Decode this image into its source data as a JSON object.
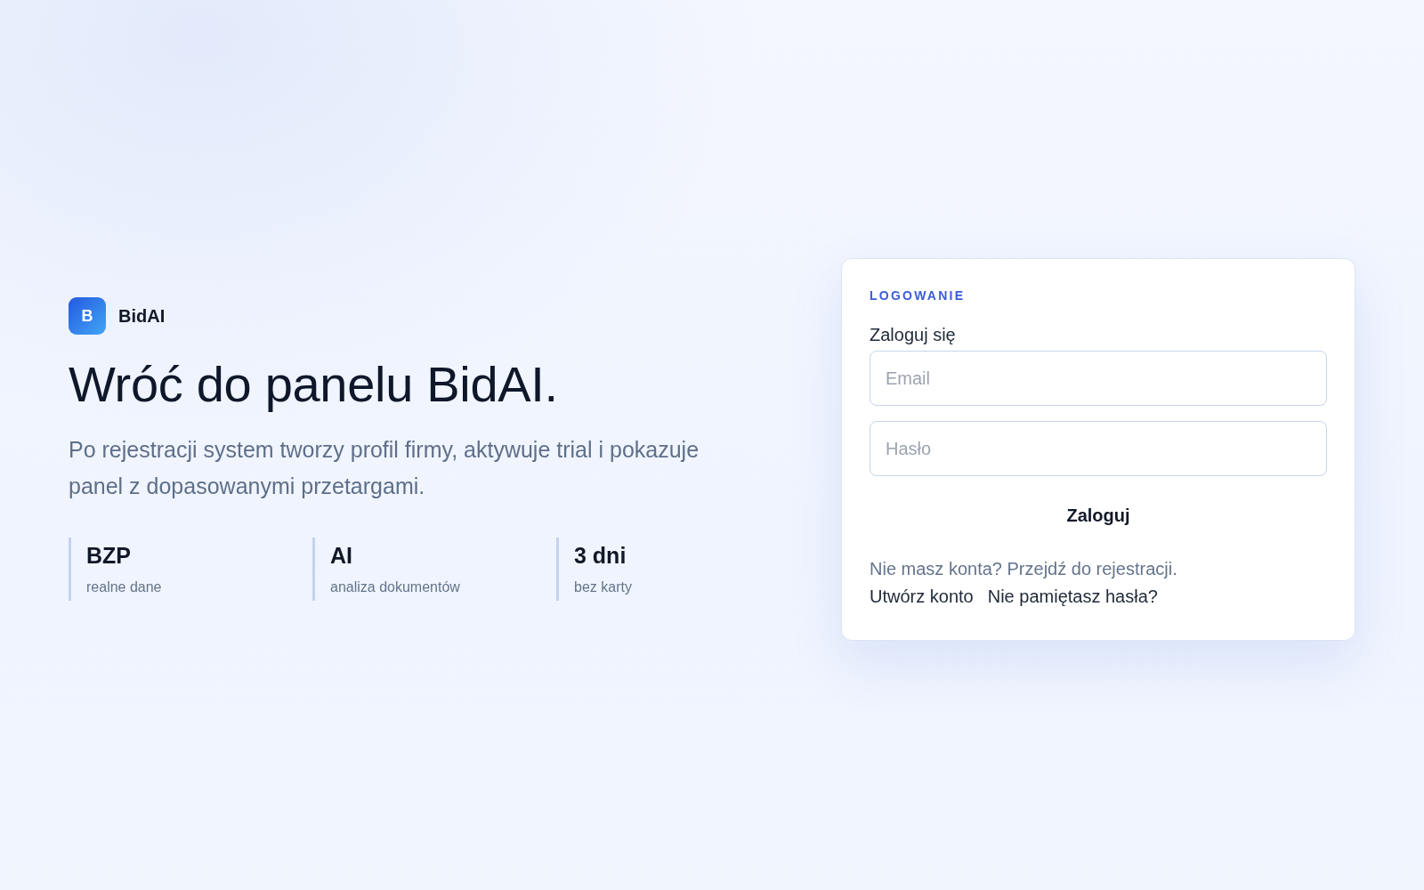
{
  "brand": {
    "logo_letter": "B",
    "name": "BidAI"
  },
  "hero": {
    "title": "Wróć do panelu BidAI.",
    "description": "Po rejestracji system tworzy profil firmy, aktywuje trial i pokazuje panel z dopasowanymi przetargami."
  },
  "stats": [
    {
      "value": "BZP",
      "label": "realne dane"
    },
    {
      "value": "AI",
      "label": "analiza dokumentów"
    },
    {
      "value": "3 dni",
      "label": "bez karty"
    }
  ],
  "login_card": {
    "eyebrow": "LOGOWANIE",
    "heading": "Zaloguj się",
    "fields": [
      {
        "placeholder": "Email"
      },
      {
        "placeholder": "Hasło"
      }
    ],
    "submit": "Zaloguj",
    "register_prompt": "Nie masz konta? Przejdź do rejestracji.",
    "links": [
      "Utwórz konto",
      "Nie pamiętasz hasła?"
    ]
  }
}
